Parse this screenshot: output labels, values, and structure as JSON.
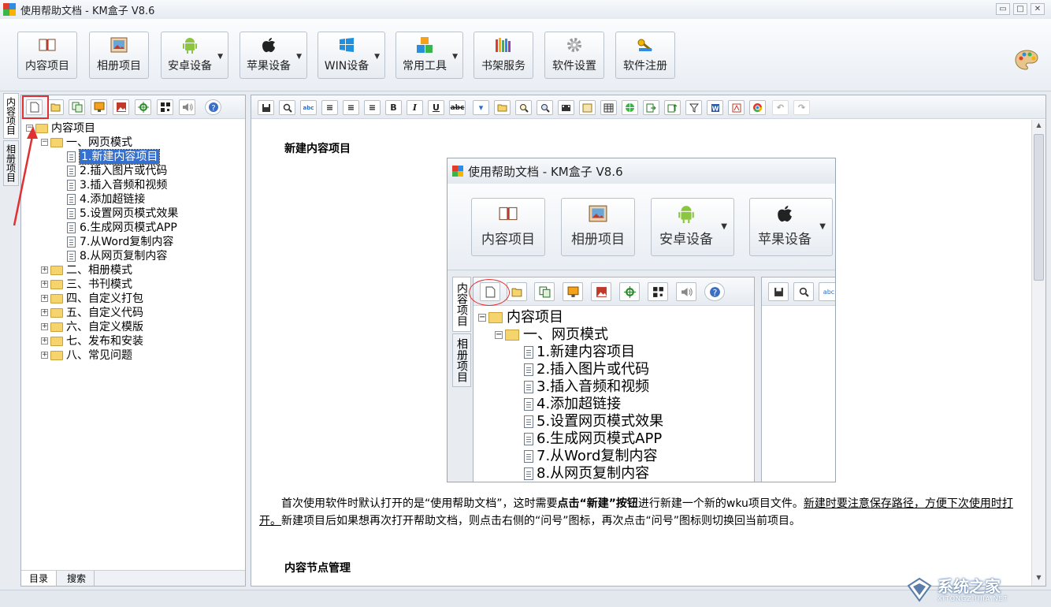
{
  "window": {
    "title": "使用帮助文档 - KM盒子 V8.6",
    "controls": [
      "▭",
      "□",
      "✕"
    ]
  },
  "toolbar": {
    "items": [
      {
        "label": "内容项目",
        "icon": "book-icon",
        "dropdown": false
      },
      {
        "label": "相册项目",
        "icon": "photo-album-icon",
        "dropdown": false
      },
      {
        "label": "安卓设备",
        "icon": "android-icon",
        "dropdown": true
      },
      {
        "label": "苹果设备",
        "icon": "apple-icon",
        "dropdown": true
      },
      {
        "label": "WIN设备",
        "icon": "windows-icon",
        "dropdown": true
      },
      {
        "label": "常用工具",
        "icon": "tools-icon",
        "dropdown": true
      },
      {
        "label": "书架服务",
        "icon": "bookshelf-icon",
        "dropdown": false
      },
      {
        "label": "软件设置",
        "icon": "gear-icon",
        "dropdown": false
      },
      {
        "label": "软件注册",
        "icon": "key-icon",
        "dropdown": false
      }
    ]
  },
  "side_tabs": [
    "内容项目",
    "相册项目"
  ],
  "left_panel": {
    "bottom_tabs": [
      "目录",
      "搜索"
    ],
    "tree": [
      {
        "level": 0,
        "type": "folder",
        "expander": "⊟",
        "label": "内容项目"
      },
      {
        "level": 1,
        "type": "folder",
        "expander": "⊟",
        "label": "一、网页模式"
      },
      {
        "level": 2,
        "type": "doc",
        "label": "1.新建内容项目",
        "selected": true
      },
      {
        "level": 2,
        "type": "doc",
        "label": "2.插入图片或代码"
      },
      {
        "level": 2,
        "type": "doc",
        "label": "3.插入音频和视频"
      },
      {
        "level": 2,
        "type": "doc",
        "label": "4.添加超链接"
      },
      {
        "level": 2,
        "type": "doc",
        "label": "5.设置网页模式效果"
      },
      {
        "level": 2,
        "type": "doc",
        "label": "6.生成网页模式APP"
      },
      {
        "level": 2,
        "type": "doc",
        "label": "7.从Word复制内容"
      },
      {
        "level": 2,
        "type": "doc",
        "label": "8.从网页复制内容"
      },
      {
        "level": 1,
        "type": "folder",
        "expander": "⊞",
        "label": "二、相册模式"
      },
      {
        "level": 1,
        "type": "folder",
        "expander": "⊞",
        "label": "三、书刊模式"
      },
      {
        "level": 1,
        "type": "folder",
        "expander": "⊞",
        "label": "四、自定义打包"
      },
      {
        "level": 1,
        "type": "folder",
        "expander": "⊞",
        "label": "五、自定义代码"
      },
      {
        "level": 1,
        "type": "folder",
        "expander": "⊞",
        "label": "六、自定义模版"
      },
      {
        "level": 1,
        "type": "folder",
        "expander": "⊞",
        "label": "七、发布和安装"
      },
      {
        "level": 1,
        "type": "folder",
        "expander": "⊞",
        "label": "八、常见问题"
      }
    ]
  },
  "editor": {
    "bold_label": "B",
    "italic_label": "I",
    "underline_label": "U",
    "heading": "新建内容项目",
    "para_part1": "首次使用软件时默认打开的是“使用帮助文档”，这时需要",
    "para_bold": "点击“新建”按钮",
    "para_part2": "进行新建一个新的wku项目文件。",
    "para_underline": "新建时要注意保存路径，方便下次使用时打开。",
    "para_part3": "新建项目后如果想再次打开帮助文档，则点击右侧的“问号”图标，再次点击“问号”图标则切换回当前项目。",
    "heading2": "内容节点管理"
  },
  "embedded": {
    "title": "使用帮助文档 - KM盒子 V8.6",
    "toolbar": [
      {
        "label": "内容项目",
        "icon": "book-icon",
        "dropdown": false
      },
      {
        "label": "相册项目",
        "icon": "photo-album-icon",
        "dropdown": false
      },
      {
        "label": "安卓设备",
        "icon": "android-icon",
        "dropdown": true
      },
      {
        "label": "苹果设备",
        "icon": "apple-icon",
        "dropdown": true
      }
    ],
    "side_tabs": [
      "内容项目",
      "相册项目"
    ],
    "tree": [
      {
        "level": 0,
        "type": "folder",
        "expander": "⊟",
        "label": "内容项目"
      },
      {
        "level": 1,
        "type": "folder",
        "expander": "⊟",
        "label": "一、网页模式"
      },
      {
        "level": 2,
        "type": "doc",
        "label": "1.新建内容项目"
      },
      {
        "level": 2,
        "type": "doc",
        "label": "2.插入图片或代码"
      },
      {
        "level": 2,
        "type": "doc",
        "label": "3.插入音频和视频"
      },
      {
        "level": 2,
        "type": "doc",
        "label": "4.添加超链接"
      },
      {
        "level": 2,
        "type": "doc",
        "label": "5.设置网页模式效果"
      },
      {
        "level": 2,
        "type": "doc",
        "label": "6.生成网页模式APP"
      },
      {
        "level": 2,
        "type": "doc",
        "label": "7.从Word复制内容"
      },
      {
        "level": 2,
        "type": "doc",
        "label": "8.从网页复制内容"
      }
    ]
  },
  "watermark": {
    "text": "系统之家",
    "sub": "XITONGZHIJIA.NET"
  },
  "colors": {
    "accent": "#3370d0",
    "annotation_red": "#e03030"
  }
}
